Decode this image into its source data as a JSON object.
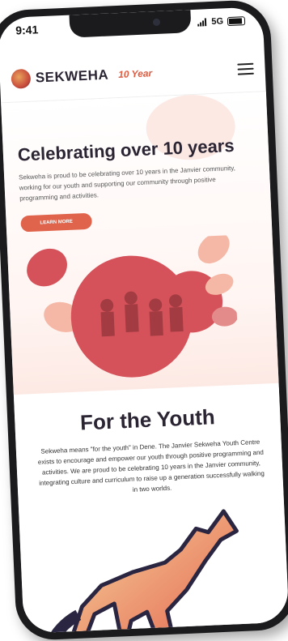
{
  "status_bar": {
    "time": "9:41",
    "network": "5G"
  },
  "header": {
    "brand": "SEKWEHA",
    "year_badge": "10 Year"
  },
  "hero": {
    "title": "Celebrating over 10 years",
    "body": "Sekweha is proud to be celebrating over 10 years in the Janvier community, working for our youth and supporting our community through positive programming and activities.",
    "button": "LEARN MORE"
  },
  "youth": {
    "title": "For the Youth",
    "body": "Sekweha means \"for the youth\" in Dene. The Janvier Sekweha Youth Centre exists to encourage and empower our youth through positive programming and activities. We are proud to be celebrating 10 years in the Janvier community, integrating culture and curriculum to raise up a generation successfully walking in two worlds."
  },
  "colors": {
    "accent": "#e0644b",
    "dark": "#2b2433",
    "collage": "#d5525a",
    "collage_light": "#f6b8a6"
  },
  "icons": [
    "signal-icon",
    "battery-icon",
    "logo-icon",
    "hamburger-icon",
    "wolf-illustration"
  ]
}
